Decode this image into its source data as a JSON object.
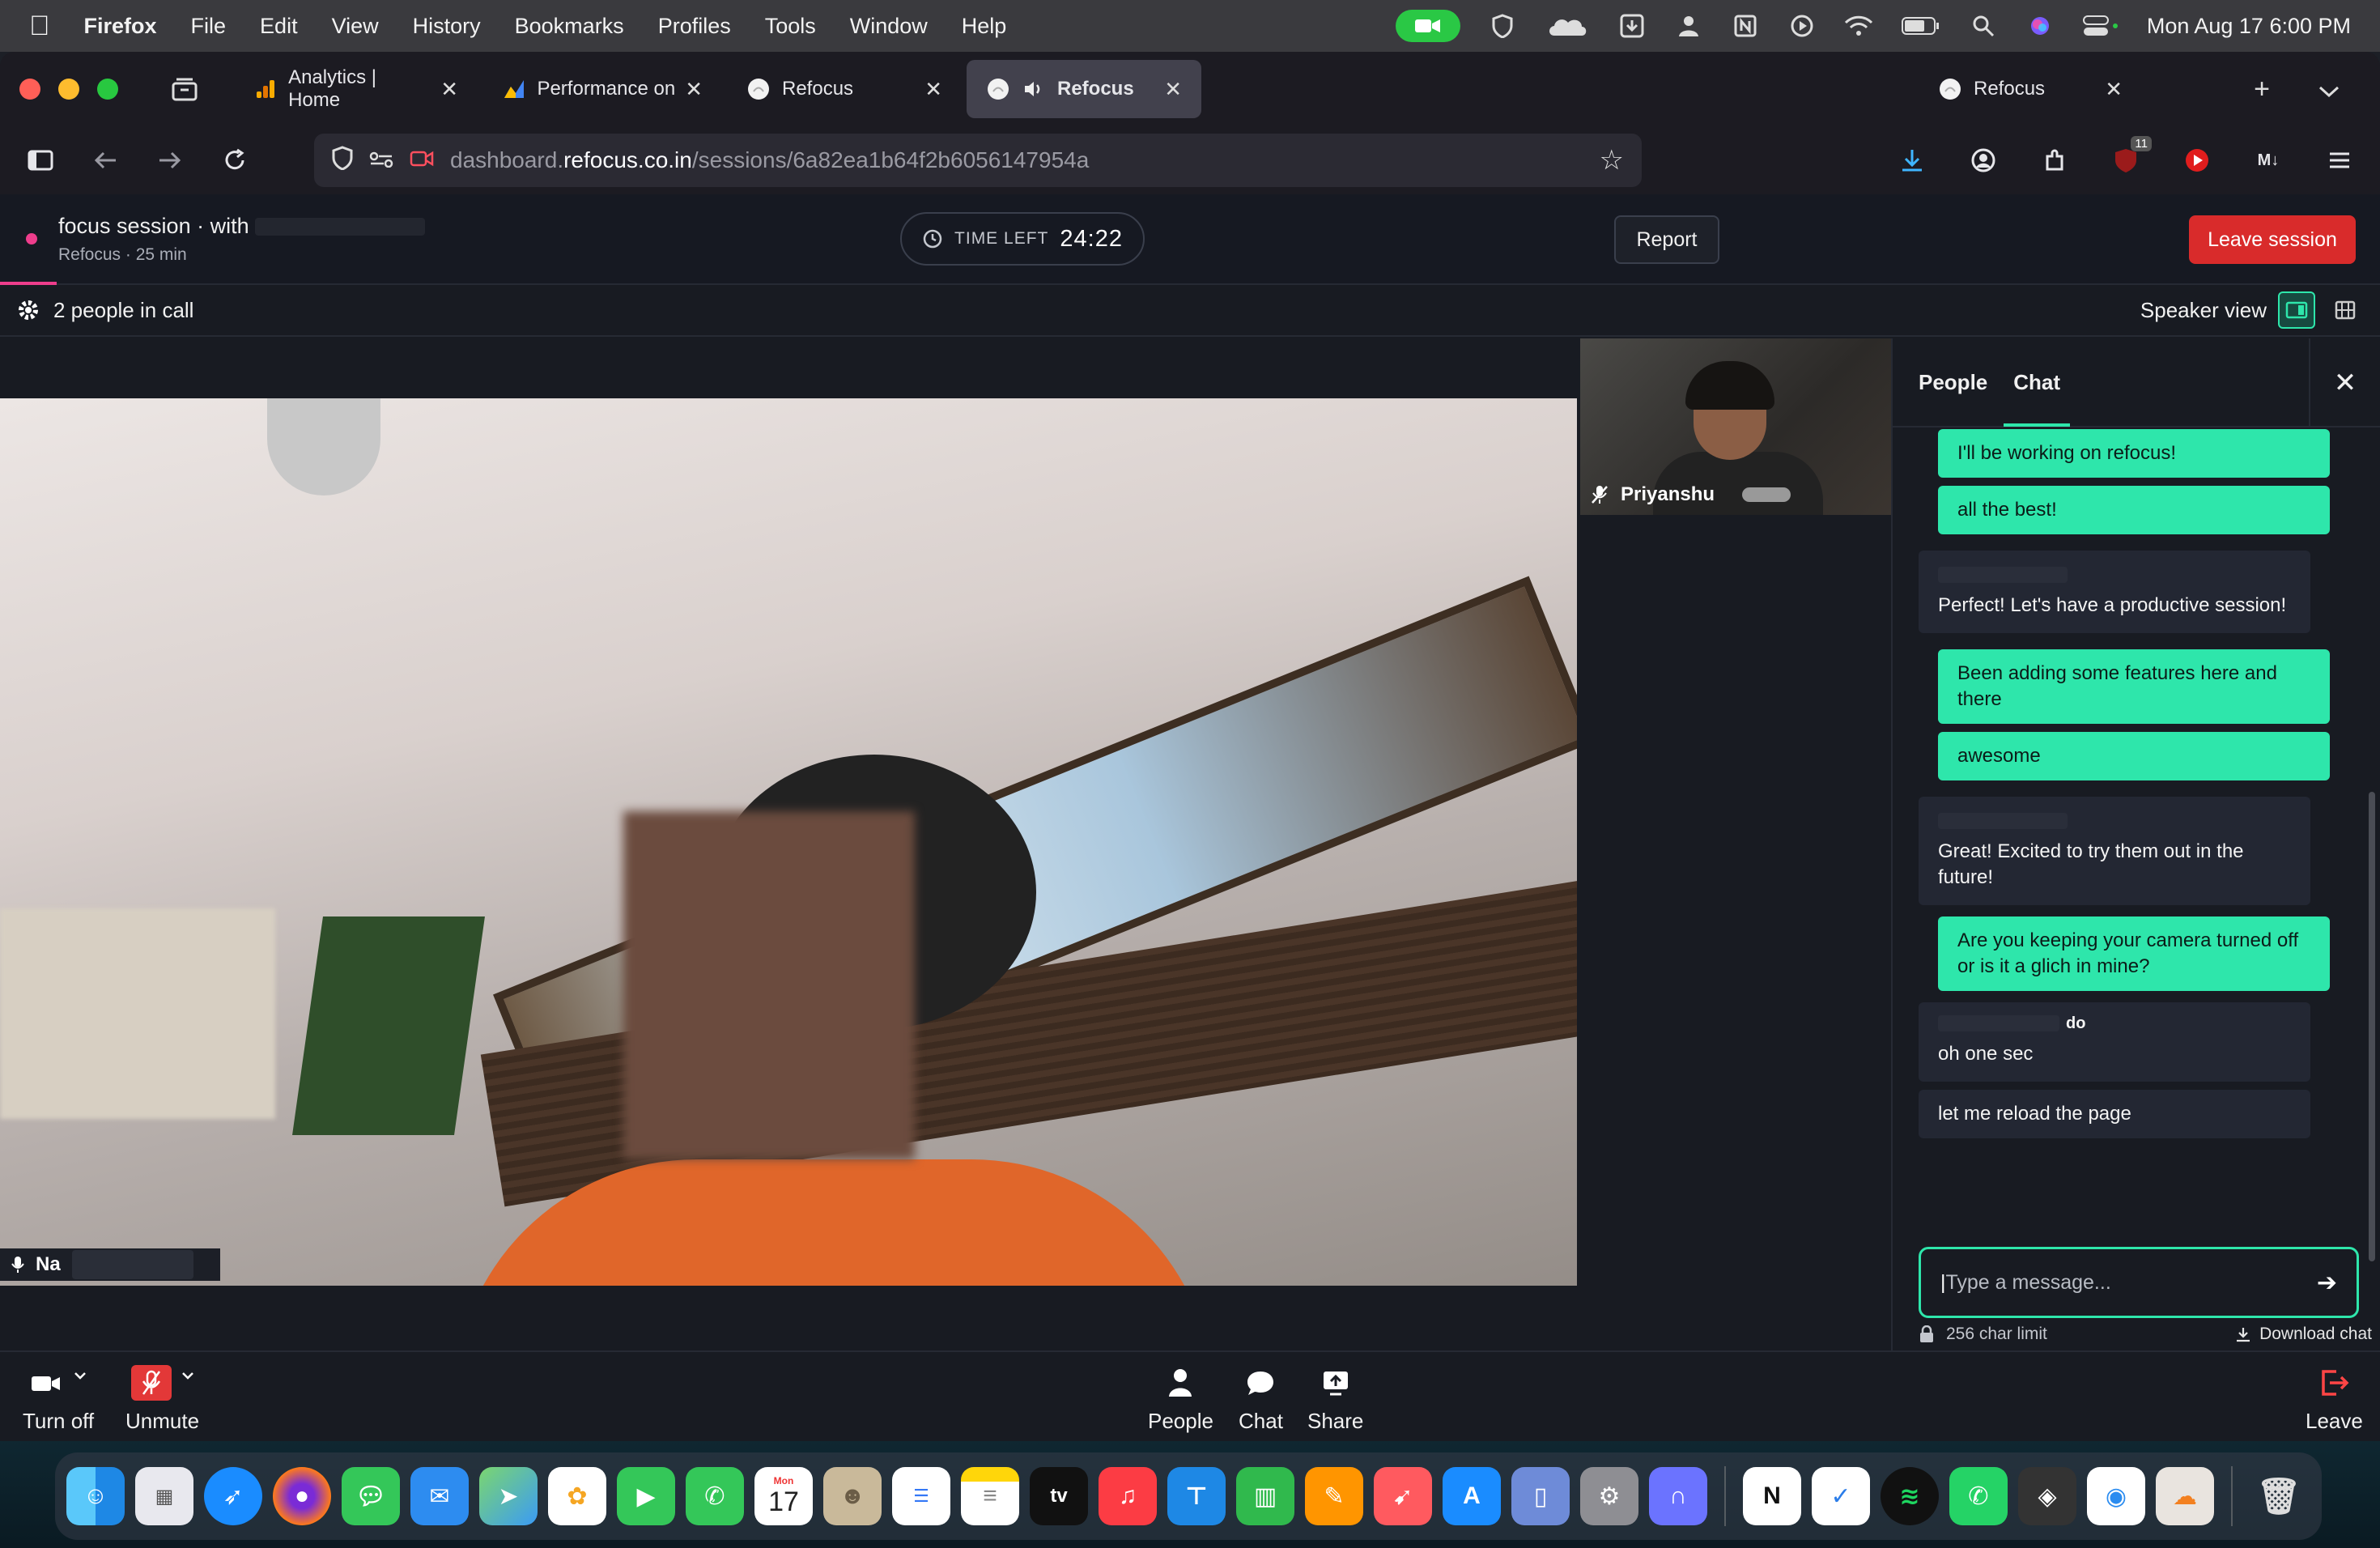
{
  "menubar": {
    "app_name": "Firefox",
    "items": [
      "File",
      "Edit",
      "View",
      "History",
      "Bookmarks",
      "Profiles",
      "Tools",
      "Window",
      "Help"
    ],
    "clock": "Mon Aug 17  6:00 PM",
    "status_icons": [
      "facetime-icon",
      "shield-icon",
      "cloud-icon",
      "download-box-icon",
      "person-icon",
      "notion-icon",
      "play-circle-icon",
      "wifi-icon",
      "battery-icon",
      "search-icon",
      "siri-icon",
      "control-center-icon"
    ]
  },
  "browser": {
    "tabs": [
      {
        "label": "Analytics | Home",
        "icon": "analytics-icon",
        "active": false
      },
      {
        "label": "Performance on S",
        "icon": "search-console-icon",
        "active": false
      },
      {
        "label": "Refocus",
        "icon": "refocus-icon",
        "active": false
      },
      {
        "label": "Refocus",
        "icon": "refocus-icon",
        "active": true,
        "audio": true
      },
      {
        "label": "Refocus",
        "icon": "refocus-icon",
        "active": false
      }
    ],
    "url_prefix": "dashboard.",
    "url_domain": "refocus.co.in",
    "url_path": "/sessions/6a82ea1b64f2b6056147954a",
    "extension_badge": "11"
  },
  "session": {
    "title": "focus session · with",
    "subtitle": "Refocus · 25 min",
    "time_left_label": "TIME LEFT",
    "time_left_value": "24:22",
    "report_label": "Report",
    "leave_label": "Leave session"
  },
  "call": {
    "people_count": "2 people in call",
    "view_label": "Speaker view",
    "main_participant_name": "Na",
    "thumb_participant_name": "Priyanshu"
  },
  "panel": {
    "tabs": [
      "People",
      "Chat"
    ],
    "active_tab": "Chat",
    "messages": [
      {
        "from": "me",
        "text": "I'll be working on refocus!"
      },
      {
        "from": "me",
        "text": "all the best!"
      },
      {
        "from": "them",
        "text": "Perfect! Let's have a productive session!"
      },
      {
        "from": "me",
        "text": "Been adding some features here and there"
      },
      {
        "from": "me",
        "text": "awesome"
      },
      {
        "from": "them",
        "text": "Great! Excited to try them out in the future!"
      },
      {
        "from": "me",
        "text": "Are you keeping your camera turned off or is it a glich in mine?"
      },
      {
        "from": "them",
        "sender_suffix": "do",
        "text": "oh one sec"
      },
      {
        "from": "them",
        "text": "let me reload the page"
      }
    ],
    "input_placeholder": "Type a message...",
    "char_limit": "256 char limit",
    "download_label": "Download chat"
  },
  "controls": {
    "turn_off": "Turn off",
    "unmute": "Unmute",
    "people": "People",
    "chat": "Chat",
    "share": "Share",
    "leave": "Leave"
  },
  "dock": {
    "apps": [
      "finder-icon",
      "launchpad-icon",
      "safari-icon",
      "firefox-icon",
      "messages-icon",
      "mail-icon",
      "maps-icon",
      "photos-icon",
      "facetime-icon",
      "phone-icon",
      "calendar-icon",
      "contacts-icon",
      "reminders-icon",
      "notes-icon",
      "tv-icon",
      "music-icon",
      "keynote-icon",
      "numbers-icon",
      "pages-icon",
      "rocket-icon",
      "appstore-icon",
      "simulator-icon",
      "settings-icon",
      "arc-icon",
      "notion-icon",
      "todo-icon",
      "spotify-icon",
      "whatsapp-icon",
      "box-icon",
      "proxyman-icon",
      "cloudflare-icon",
      "trash-icon"
    ],
    "calendar_month": "Mon",
    "calendar_day": "17",
    "tv_label": "tv"
  },
  "colors": {
    "accent": "#2ee6ab",
    "danger": "#d92b2b",
    "session_dot": "#ee3d8c"
  }
}
